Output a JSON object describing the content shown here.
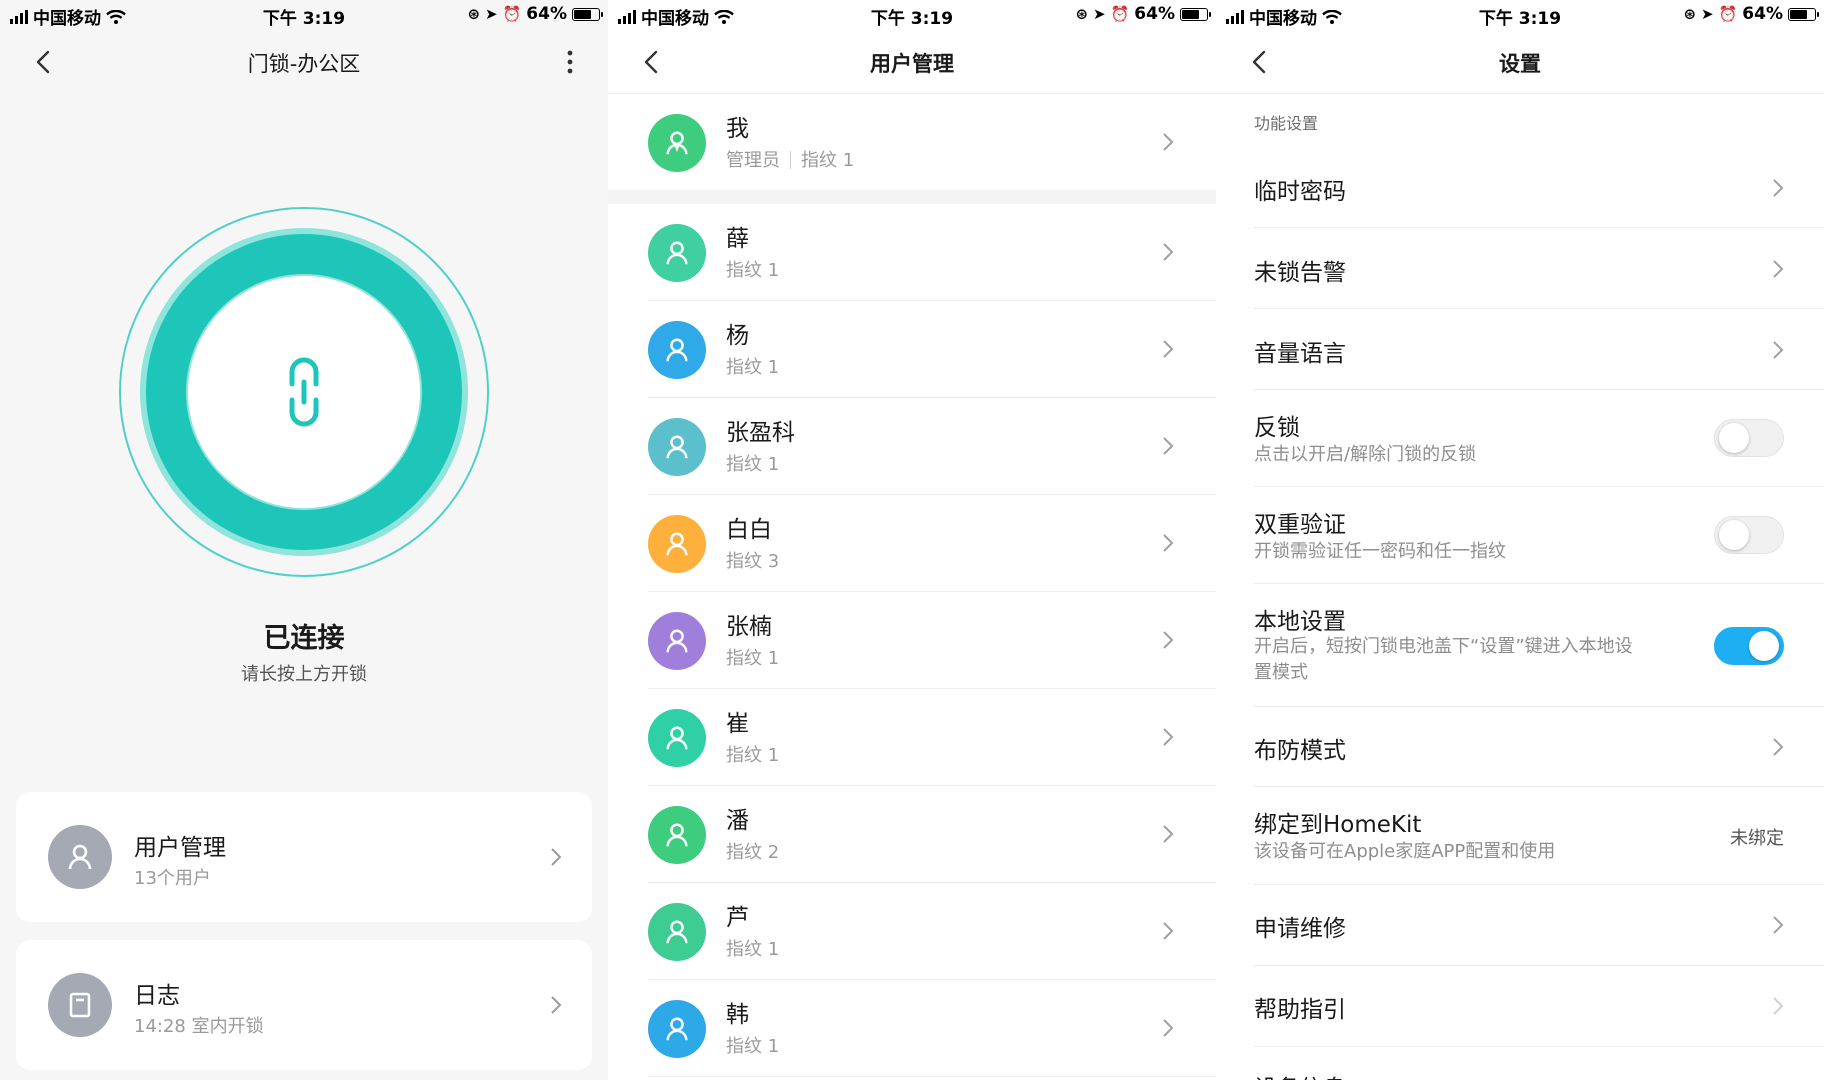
{
  "status_bar": {
    "carrier": "中国移动",
    "time": "下午 3:19",
    "battery": "64%"
  },
  "screen1": {
    "title": "门锁-办公区",
    "lock_state": "已连接",
    "lock_hint": "请长按上方开锁",
    "ring_color": "#1dc6b8",
    "user_card": {
      "title": "用户管理",
      "subtitle": "13个用户"
    },
    "log_card": {
      "title": "日志",
      "subtitle": "14:28 室内开锁"
    }
  },
  "screen2": {
    "title": "用户管理",
    "me": {
      "name": "我",
      "role": "管理员",
      "fingerprint": "指纹 1",
      "color": "#3ecd7e"
    },
    "users": [
      {
        "name": "薛",
        "fingerprint": "指纹 1",
        "color": "#3fcfa0"
      },
      {
        "name": "杨",
        "fingerprint": "指纹 1",
        "color": "#30a9e9"
      },
      {
        "name": "张盈科",
        "fingerprint": "指纹 1",
        "color": "#5bbfcc"
      },
      {
        "name": "白白",
        "fingerprint": "指纹 3",
        "color": "#fdb03c"
      },
      {
        "name": "张楠",
        "fingerprint": "指纹 1",
        "color": "#9f7fdb"
      },
      {
        "name": "崔",
        "fingerprint": "指纹 1",
        "color": "#2fd0a5"
      },
      {
        "name": "潘",
        "fingerprint": "指纹 2",
        "color": "#3ecd7e"
      },
      {
        "name": "芦",
        "fingerprint": "指纹 1",
        "color": "#3dcc92"
      },
      {
        "name": "韩",
        "fingerprint": "指纹 1",
        "color": "#2ea9e8"
      }
    ],
    "fab_color": "#1eaff2"
  },
  "screen3": {
    "title": "设置",
    "section": "功能设置",
    "rows": {
      "temp_password": "临时密码",
      "unlock_alarm": "未锁告警",
      "volume_language": "音量语言",
      "deadlock": {
        "label": "反锁",
        "desc": "点击以开启/解除门锁的反锁",
        "on": false
      },
      "dual_verify": {
        "label": "双重验证",
        "desc": "开锁需验证任一密码和任一指纹",
        "on": false
      },
      "local_settings": {
        "label": "本地设置",
        "desc": "开启后，短按门锁电池盖下“设置”键进入本地设置模式",
        "on": true
      },
      "arm_mode": "布防模式",
      "homekit": {
        "label": "绑定到HomeKit",
        "desc": "该设备可在Apple家庭APP配置和使用",
        "value": "未绑定"
      },
      "repair": "申请维修",
      "help": "帮助指引",
      "device_info": "设备信息"
    },
    "accent_color": "#1eaff2"
  }
}
